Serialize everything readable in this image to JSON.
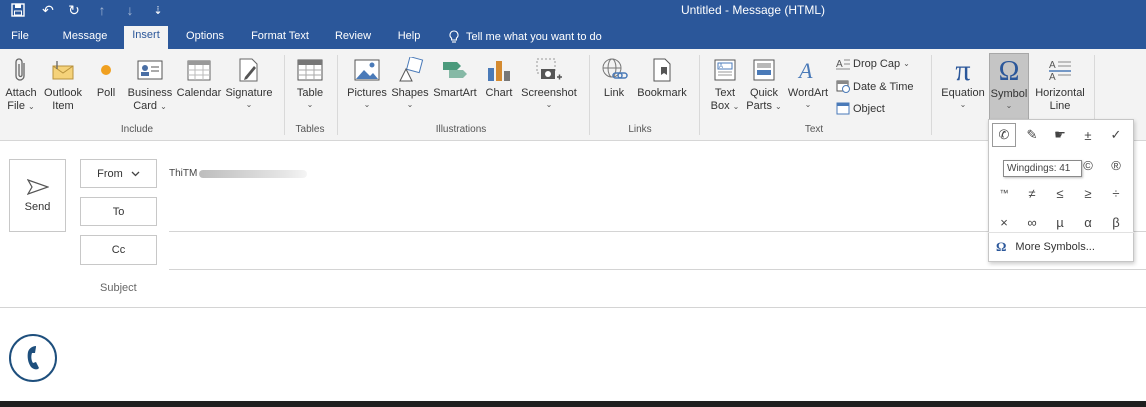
{
  "titlebar": {
    "title": "Untitled  -  Message (HTML)",
    "save_icon": "save-icon",
    "undo_icon": "undo-icon",
    "redo_icon": "redo-icon",
    "up_icon": "up-arrow-icon",
    "down_icon": "down-arrow-icon",
    "customize_icon": "customize-quick-access-icon",
    "undo_glyph": "↶",
    "redo_glyph": "↻",
    "up_glyph": "↑",
    "down_glyph": "↓",
    "customize_glyph": "⇣"
  },
  "tabs": [
    {
      "label": "File"
    },
    {
      "label": "Message"
    },
    {
      "label": "Insert"
    },
    {
      "label": "Options"
    },
    {
      "label": "Format Text"
    },
    {
      "label": "Review"
    },
    {
      "label": "Help"
    }
  ],
  "tell_me": "Tell me what you want to do",
  "ribbon": {
    "attach": {
      "line1": "Attach",
      "line2": "File"
    },
    "outlook_item": {
      "line1": "Outlook",
      "line2": "Item"
    },
    "poll": {
      "line1": "Poll"
    },
    "business_card": {
      "line1": "Business",
      "line2": "Card"
    },
    "calendar": {
      "line1": "Calendar"
    },
    "signature": {
      "line1": "Signature"
    },
    "table": {
      "line1": "Table"
    },
    "pictures": {
      "line1": "Pictures"
    },
    "shapes": {
      "line1": "Shapes"
    },
    "smartart": {
      "line1": "SmartArt"
    },
    "chart": {
      "line1": "Chart"
    },
    "screenshot": {
      "line1": "Screenshot"
    },
    "link": {
      "line1": "Link"
    },
    "bookmark": {
      "line1": "Bookmark"
    },
    "textbox": {
      "line1": "Text",
      "line2": "Box"
    },
    "quickparts": {
      "line1": "Quick",
      "line2": "Parts"
    },
    "wordart": {
      "line1": "WordArt"
    },
    "dropcap": "Drop Cap",
    "datetime": "Date & Time",
    "object": "Object",
    "equation": {
      "line1": "Equation",
      "glyph": "π"
    },
    "symbol": {
      "line1": "Symbol",
      "glyph": "Ω"
    },
    "horizontal_line": {
      "line1": "Horizontal",
      "line2": "Line"
    },
    "chevron": "⌄",
    "groups": {
      "include": "Include",
      "tables": "Tables",
      "illustrations": "Illustrations",
      "links": "Links",
      "text": "Text"
    }
  },
  "compose": {
    "send": "Send",
    "from": "From",
    "from_value": "ThiTM",
    "to": "To",
    "cc": "Cc",
    "subject": "Subject"
  },
  "symbols": {
    "rows": [
      [
        "✆",
        "✎",
        "☛",
        "±",
        "✓"
      ],
      [
        "",
        "",
        "",
        "©",
        "®"
      ],
      [
        "™",
        "≠",
        "≤",
        "≥",
        "÷"
      ],
      [
        "×",
        "∞",
        "µ",
        "α",
        "β"
      ]
    ],
    "tooltip": "Wingdings: 41",
    "more_symbols": "More Symbols...",
    "more_glyph": "Ω"
  },
  "colors": {
    "brand": "#2b579a",
    "ribbon_bg": "#f3f3f3",
    "phone_icon": "#1e4f7d"
  }
}
